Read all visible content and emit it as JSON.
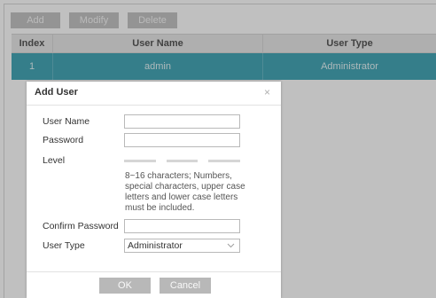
{
  "toolbar": {
    "add_label": "Add",
    "modify_label": "Modify",
    "delete_label": "Delete"
  },
  "table": {
    "columns": [
      "Index",
      "User Name",
      "User Type"
    ],
    "rows": [
      {
        "index": "1",
        "user_name": "admin",
        "user_type": "Administrator"
      }
    ]
  },
  "modal": {
    "title": "Add User",
    "close_glyph": "×",
    "fields": {
      "user_name_label": "User Name",
      "user_name_value": "",
      "password_label": "Password",
      "password_value": "",
      "level_label": "Level",
      "password_hint": "8~16 characters; Numbers, special characters, upper case letters and lower case letters must be included.",
      "confirm_password_label": "Confirm Password",
      "confirm_password_value": "",
      "user_type_label": "User Type",
      "user_type_value": "Administrator"
    },
    "ok_label": "OK",
    "cancel_label": "Cancel"
  },
  "icons": {
    "close": "close-icon",
    "dropdown": "chevron-down-icon"
  },
  "colors": {
    "selected_row": "#1f95a8",
    "button_gray": "#b8b8b8",
    "header_bg": "#e4e4e4"
  }
}
